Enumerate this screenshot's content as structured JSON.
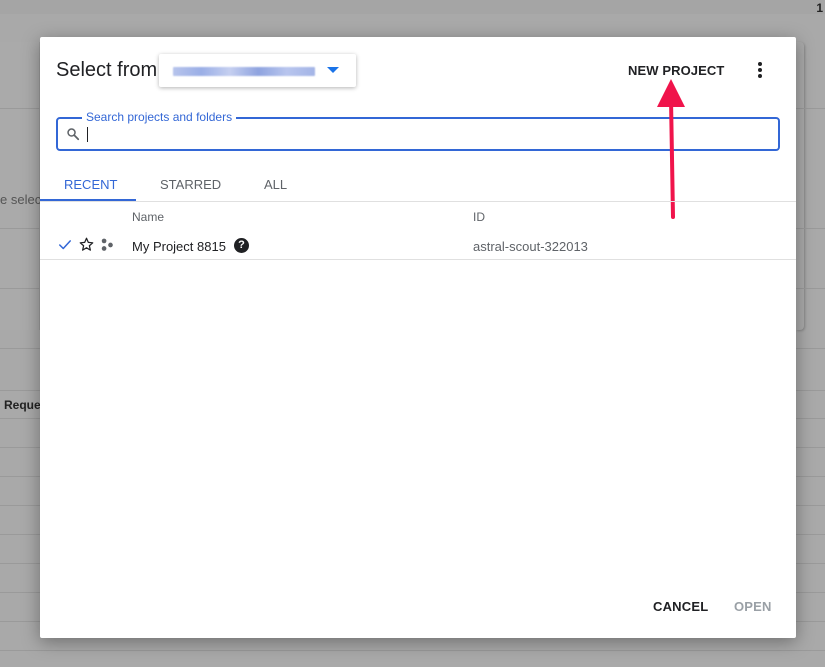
{
  "background": {
    "corner_text": "1",
    "partial_text_1": "e select",
    "partial_text_2": "Reques"
  },
  "dialog": {
    "title": "Select from",
    "new_project_label": "NEW PROJECT",
    "more_icon": "more-vert-icon"
  },
  "search": {
    "label": "Search projects and folders",
    "value": "",
    "icon": "search-icon"
  },
  "tabs": [
    {
      "label": "RECENT",
      "active": true
    },
    {
      "label": "STARRED",
      "active": false
    },
    {
      "label": "ALL",
      "active": false
    }
  ],
  "table": {
    "columns": [
      "Name",
      "ID"
    ],
    "rows": [
      {
        "name": "My Project 8815",
        "id": "astral-scout-322013",
        "selected": true,
        "starred": false
      }
    ]
  },
  "footer": {
    "cancel_label": "CANCEL",
    "open_label": "OPEN"
  },
  "colors": {
    "accent": "#3367d6",
    "annotation_arrow": "#f0144b"
  }
}
